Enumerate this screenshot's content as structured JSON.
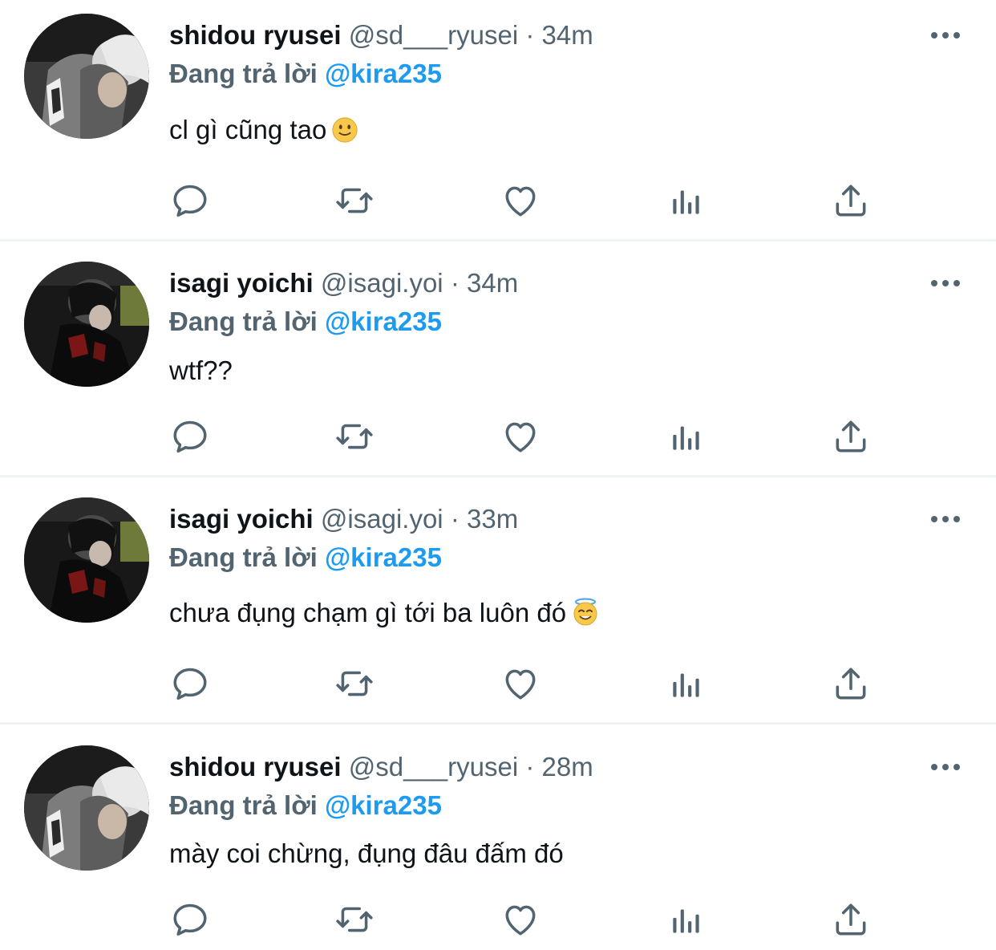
{
  "tweets": [
    {
      "display_name": "shidou ryusei",
      "handle": "@sd___ryusei",
      "dot": "·",
      "time": "34m",
      "reply_prefix": "Đang trả lời",
      "reply_target": "@kira235",
      "text": "cl gì cũng tao",
      "emoji": "slightly-smiling-face-icon",
      "avatar": "light-hair-avatar"
    },
    {
      "display_name": "isagi yoichi",
      "handle": "@isagi.yoi",
      "dot": "·",
      "time": "34m",
      "reply_prefix": "Đang trả lời",
      "reply_target": "@kira235",
      "text": "wtf??",
      "emoji": "",
      "avatar": "dark-hair-avatar"
    },
    {
      "display_name": "isagi yoichi",
      "handle": "@isagi.yoi",
      "dot": "·",
      "time": "33m",
      "reply_prefix": "Đang trả lời",
      "reply_target": "@kira235",
      "text": "chưa đụng chạm gì tới ba luôn đó",
      "emoji": "smiling-face-with-halo-icon",
      "avatar": "dark-hair-avatar"
    },
    {
      "display_name": "shidou ryusei",
      "handle": "@sd___ryusei",
      "dot": "·",
      "time": "28m",
      "reply_prefix": "Đang trả lời",
      "reply_target": "@kira235",
      "text": "mày coi chừng, đụng đâu đấm đó",
      "emoji": "",
      "avatar": "light-hair-avatar"
    }
  ],
  "icons": {
    "more": "more-dots-icon",
    "reply": "reply-icon",
    "retweet": "retweet-icon",
    "like": "like-icon",
    "views": "views-icon",
    "share": "share-icon"
  },
  "colors": {
    "name": "#0f1419",
    "secondary": "#536471",
    "link": "#1d9bf0",
    "divider": "#eff3f4"
  }
}
